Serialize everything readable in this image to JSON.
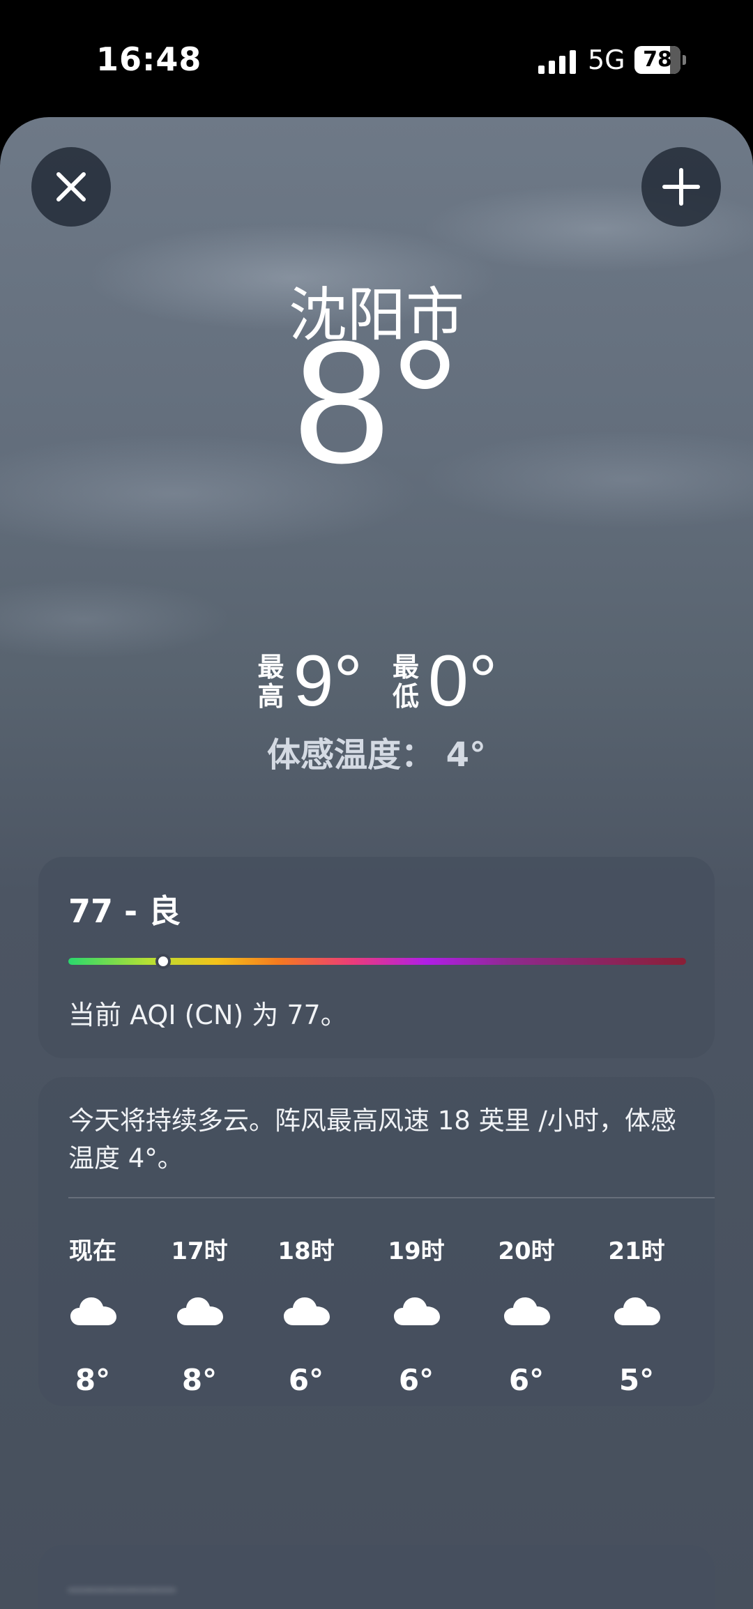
{
  "status_bar": {
    "time": "16:48",
    "network": "5G",
    "battery": "78",
    "battery_level": 0.78
  },
  "header": {
    "close_icon": "close-icon",
    "add_icon": "plus-icon"
  },
  "weather": {
    "city": "沈阳市",
    "temperature": "8°",
    "high_label": "最高",
    "high": "9°",
    "low_label": "最低",
    "low": "0°",
    "feels_like": "体感温度： 4°"
  },
  "aqi": {
    "title": "77 - 良",
    "value": 77,
    "description": "当前 AQI (CN) 为 77。"
  },
  "forecast": {
    "summary": "今天将持续多云。阵风最高风速 18 英里 /小时，体感温度 4°。",
    "hours": [
      {
        "time": "现在",
        "icon": "cloud-icon",
        "temp": "8°"
      },
      {
        "time": "17时",
        "icon": "cloud-icon",
        "temp": "8°"
      },
      {
        "time": "18时",
        "icon": "cloud-icon",
        "temp": "6°"
      },
      {
        "time": "19时",
        "icon": "cloud-icon",
        "temp": "6°"
      },
      {
        "time": "20时",
        "icon": "cloud-icon",
        "temp": "6°"
      },
      {
        "time": "21时",
        "icon": "cloud-icon",
        "temp": "5°"
      }
    ]
  },
  "colors": {
    "sheet_top": "#6e7987",
    "sheet_bottom": "#47505d",
    "card_bg": "#464f5e"
  }
}
